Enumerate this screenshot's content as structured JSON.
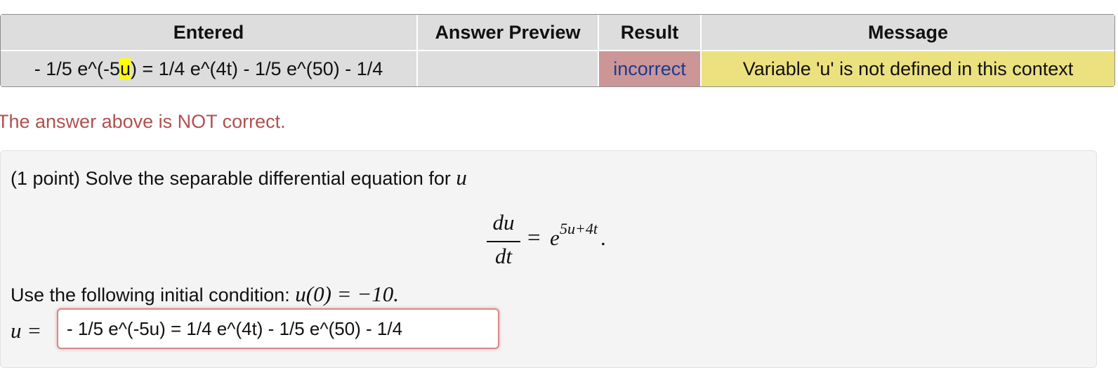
{
  "results_table": {
    "headers": {
      "entered": "Entered",
      "preview": "Answer Preview",
      "result": "Result",
      "message": "Message"
    },
    "row": {
      "entered_before": "- 1/5 e^(-5",
      "entered_highlight": "u",
      "entered_after": ") = 1/4 e^(4t) - 1/5 e^(50) - 1/4",
      "preview": "",
      "result": "incorrect",
      "message": "Variable 'u' is not defined in this context"
    }
  },
  "status_message": "The answer above is NOT correct.",
  "problem": {
    "intro_text": "(1 point) Solve the separable differential equation for",
    "intro_var": "u",
    "equation": {
      "numerator": "du",
      "denominator": "dt",
      "equals": "=",
      "base": "e",
      "exponent": "5u+4t",
      "trailing": "."
    },
    "initial_condition_text": "Use the following initial condition:",
    "initial_condition_math": "u(0) = −10.",
    "answer_label": "u =",
    "answer_value": "- 1/5 e^(-5u) = 1/4 e^(4t) - 1/5 e^(50) - 1/4"
  },
  "colors": {
    "header_bg": "#dddddd",
    "result_incorrect_bg": "#cc9696",
    "result_text": "#1a3b92",
    "message_bg": "#ece17f",
    "status_text": "#b05050",
    "highlight": "#ffff00",
    "input_border": "#d98888"
  }
}
